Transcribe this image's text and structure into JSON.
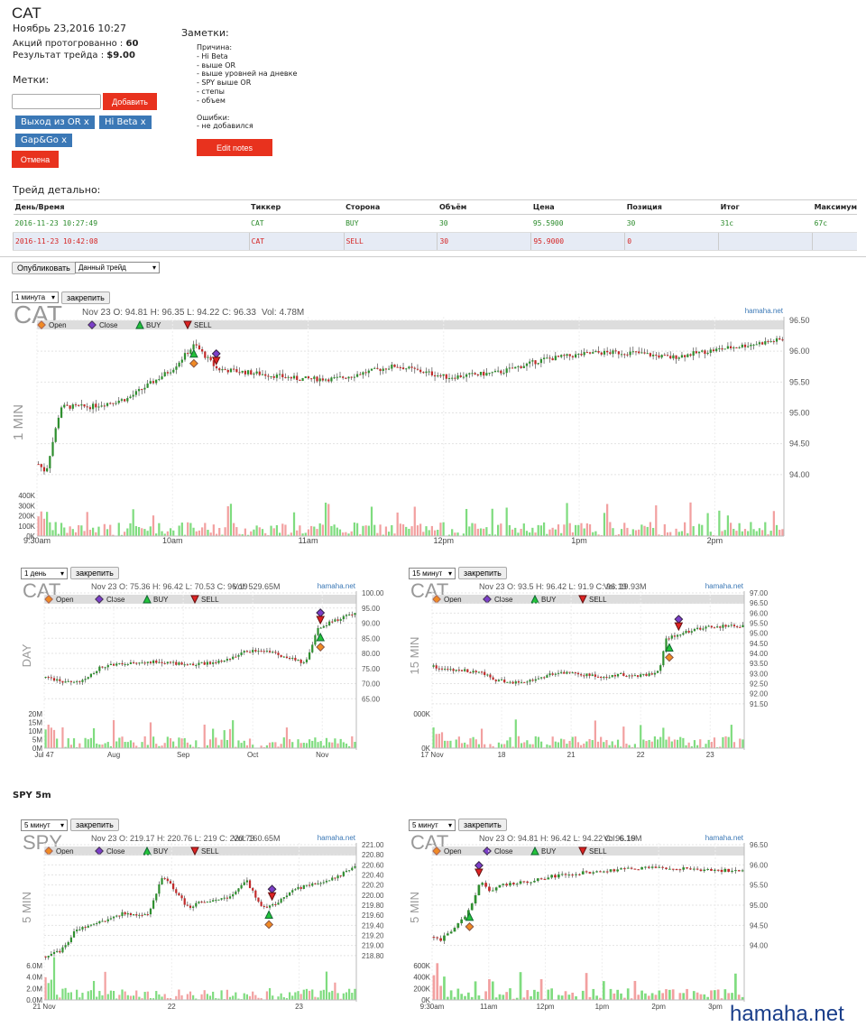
{
  "header": {
    "ticker": "CAT",
    "datetime": "Ноябрь 23,2016 10:27",
    "shares_label": "Акций протогрованно :",
    "shares_value": "60",
    "result_label": "Результат трейда :",
    "result_value": "$9.00"
  },
  "tags_section": {
    "title": "Метки:",
    "input_value": "",
    "add_label": "Добавить",
    "tags": [
      "Выход из OR x",
      "Hi Beta x",
      "Gap&Go x"
    ],
    "cancel_label": "Отмена"
  },
  "notes": {
    "title": "Заметки:",
    "reason_title": "Причина:",
    "reasons": [
      "- Hi Beta",
      "- выше OR",
      "- выше уровней на дневке",
      "- SPY выше OR",
      "- степы",
      "- объем"
    ],
    "errors_title": "Ошибки:",
    "errors": [
      "- не добавился"
    ],
    "edit_label": "Edit notes"
  },
  "trade_detail": {
    "title": "Трейд детально:",
    "columns": [
      "День/Время",
      "Тиккер",
      "Сторона",
      "Объём",
      "Цена",
      "Позиция",
      "Итог",
      "Максимум"
    ],
    "rows": [
      [
        "2016-11-23 10:27:49",
        "CAT",
        "BUY",
        "30",
        "95.5900",
        "30",
        "31c",
        "67c"
      ],
      [
        "2016-11-23 10:42:08",
        "CAT",
        "SELL",
        "30",
        "95.9000",
        "0",
        "",
        ""
      ]
    ]
  },
  "publish": {
    "button": "Опубликовать",
    "select": "Данный трейд"
  },
  "spy_title": "SPY 5m",
  "watermark": "hamaha.net",
  "colors": {
    "red_button": "#e8321e",
    "tag_blue": "#3b78b6",
    "buy_green": "#2a8a2a",
    "sell_red": "#d52424",
    "up_candle": "#2f8f2f",
    "down_candle": "#c22a2a"
  },
  "charts": [
    {
      "id": "c1",
      "interval_select": "1 минута",
      "pin_label": "закрепить",
      "symbol": "CAT",
      "ohlc": "Nov 23 O: 94.81 H: 96.35 L: 94.22 C: 96.33",
      "vol": "Vol: 4.78M",
      "brand": "hamaha.net",
      "side_label": "1 MIN",
      "legend": [
        "Open",
        "Close",
        "BUY",
        "SELL"
      ],
      "y_ticks": [
        "96.50",
        "96.00",
        "95.50",
        "95.00",
        "94.50",
        "94.00"
      ],
      "vol_ticks": [
        "400K",
        "300K",
        "200K",
        "100K",
        "0K"
      ],
      "x_ticks": [
        "9:30am",
        "10am",
        "11am",
        "12pm",
        "1pm",
        "2pm"
      ]
    },
    {
      "id": "c2",
      "interval_select": "1 день",
      "pin_label": "закрепить",
      "symbol": "CAT",
      "ohlc": "Nov 23 O: 75.36 H: 96.42 L: 70.53 C: 96.19",
      "vol": "Vol: 529.65M",
      "brand": "hamaha.net",
      "side_label": "DAY",
      "legend": [
        "Open",
        "Close",
        "BUY",
        "SELL"
      ],
      "y_ticks": [
        "100.00",
        "95.00",
        "90.00",
        "85.00",
        "80.00",
        "75.00",
        "70.00",
        "65.00"
      ],
      "vol_ticks": [
        "20M",
        "15M",
        "10M",
        "5M",
        "0M"
      ],
      "x_ticks": [
        "Jul 47",
        "Aug",
        "Sep",
        "Oct",
        "Nov"
      ]
    },
    {
      "id": "c3",
      "interval_select": "15 минут",
      "pin_label": "закрепить",
      "symbol": "CAT",
      "ohlc": "Nov 23 O: 93.5 H: 96.42 L: 91.9 C: 96.19",
      "vol": "Vol: 19.93M",
      "brand": "hamaha.net",
      "side_label": "15 MIN",
      "legend": [
        "Open",
        "Close",
        "BUY",
        "SELL"
      ],
      "y_ticks": [
        "97.00",
        "96.50",
        "96.00",
        "95.50",
        "95.00",
        "94.50",
        "94.00",
        "93.50",
        "93.00",
        "92.50",
        "92.00",
        "91.50"
      ],
      "vol_ticks": [
        "000K",
        "0K"
      ],
      "x_ticks": [
        "17 Nov",
        "18",
        "21",
        "22",
        "23"
      ]
    },
    {
      "id": "c4",
      "interval_select": "5 минут",
      "pin_label": "закрепить",
      "symbol": "SPY",
      "ohlc": "Nov 23 O: 219.17 H: 220.76 L: 219 C: 220.73",
      "vol": "Vol: 160.65M",
      "brand": "hamaha.net",
      "side_label": "5 MIN",
      "legend": [
        "Open",
        "Close",
        "BUY",
        "SELL"
      ],
      "y_ticks": [
        "221.00",
        "220.80",
        "220.60",
        "220.40",
        "220.20",
        "220.00",
        "219.80",
        "219.60",
        "219.40",
        "219.20",
        "219.00",
        "218.80"
      ],
      "vol_ticks": [
        "6.0M",
        "4.0M",
        "2.0M",
        "0.0M"
      ],
      "x_ticks": [
        "21 Nov",
        "22",
        "23"
      ]
    },
    {
      "id": "c5",
      "interval_select": "5 минут",
      "pin_label": "закрепить",
      "symbol": "CAT",
      "ohlc": "Nov 23 O: 94.81 H: 96.42 L: 94.22 C: 96.19",
      "vol": "Vol: 6.16M",
      "brand": "hamaha.net",
      "side_label": "5 MIN",
      "legend": [
        "Open",
        "Close",
        "BUY",
        "SELL"
      ],
      "y_ticks": [
        "96.50",
        "96.00",
        "95.50",
        "95.00",
        "94.50",
        "94.00"
      ],
      "vol_ticks": [
        "600K",
        "400K",
        "200K",
        "0K"
      ],
      "x_ticks": [
        "9:30am",
        "11am",
        "12pm",
        "1pm",
        "2pm",
        "3pm"
      ]
    }
  ]
}
